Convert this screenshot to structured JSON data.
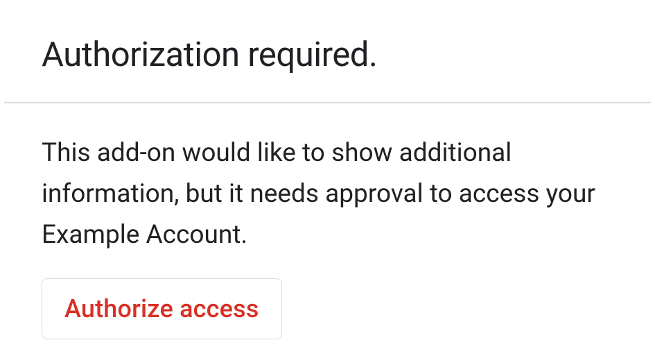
{
  "header": {
    "title": "Authorization required."
  },
  "content": {
    "description": "This add-on would like to show additional information, but it needs approval to access your Example Account.",
    "authorize_label": "Authorize access"
  }
}
